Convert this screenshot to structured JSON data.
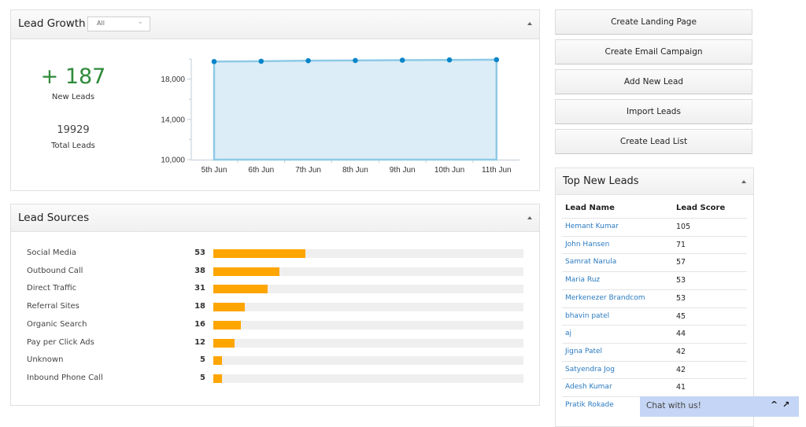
{
  "lead_growth": {
    "title": "Lead Growth",
    "range_select": {
      "value": "All"
    },
    "new_leads": {
      "value": "+ 187",
      "label": "New Leads"
    },
    "total_leads": {
      "value": "19929",
      "label": "Total Leads"
    }
  },
  "chart_data": {
    "type": "area",
    "title": "",
    "xlabel": "",
    "ylabel": "",
    "categories": [
      "5th Jun",
      "6th Jun",
      "7th Jun",
      "8th Jun",
      "9th Jun",
      "10th Jun",
      "11th Jun"
    ],
    "series": [
      {
        "name": "Total Leads",
        "values": [
          19742,
          19775,
          19830,
          19850,
          19880,
          19905,
          19929
        ]
      }
    ],
    "ylim": [
      10000,
      20000
    ],
    "y_ticks": [
      10000,
      14000,
      18000
    ],
    "y_tick_labels": [
      "10,000",
      "14,000",
      "18,000"
    ],
    "y_minor_ticks": [
      12000,
      16000,
      20000
    ],
    "grid": false,
    "colors": {
      "line": "#8ecae6",
      "fill": "#ddedf7",
      "point": "#0a85c9"
    }
  },
  "lead_sources": {
    "title": "Lead Sources",
    "bar_color": "#ffa500",
    "track_color": "#efefef",
    "items": [
      {
        "label": "Social Media",
        "count": "53",
        "value": 53
      },
      {
        "label": "Outbound Call",
        "count": "38",
        "value": 38
      },
      {
        "label": "Direct Traffic",
        "count": "31",
        "value": 31
      },
      {
        "label": "Referral Sites",
        "count": "18",
        "value": 18
      },
      {
        "label": "Organic Search",
        "count": "16",
        "value": 16
      },
      {
        "label": "Pay per Click Ads",
        "count": "12",
        "value": 12
      },
      {
        "label": "Unknown",
        "count": "5",
        "value": 5
      },
      {
        "label": "Inbound Phone Call",
        "count": "5",
        "value": 5
      }
    ]
  },
  "actions": [
    {
      "label": "Create Landing Page"
    },
    {
      "label": "Create Email Campaign"
    },
    {
      "label": "Add New Lead"
    },
    {
      "label": "Import Leads"
    },
    {
      "label": "Create Lead List"
    }
  ],
  "top_new_leads": {
    "title": "Top New Leads",
    "columns": [
      "Lead Name",
      "Lead Score"
    ],
    "rows": [
      {
        "name": "Hemant Kumar",
        "score": "105"
      },
      {
        "name": "John Hansen",
        "score": "71"
      },
      {
        "name": "Samrat Narula",
        "score": "57"
      },
      {
        "name": "Maria Ruz",
        "score": "53"
      },
      {
        "name": "Merkenezer Brandcom",
        "score": "53"
      },
      {
        "name": "bhavin patel",
        "score": "45"
      },
      {
        "name": "aj",
        "score": "44"
      },
      {
        "name": "Jigna Patel",
        "score": "42"
      },
      {
        "name": "Satyendra Jog",
        "score": "42"
      },
      {
        "name": "Adesh Kumar",
        "score": "41"
      },
      {
        "name": "Pratik Rokade",
        "score": ""
      }
    ]
  },
  "chat": {
    "label": "Chat with us!",
    "minimize_icon": "^",
    "popout_icon": "↗"
  }
}
